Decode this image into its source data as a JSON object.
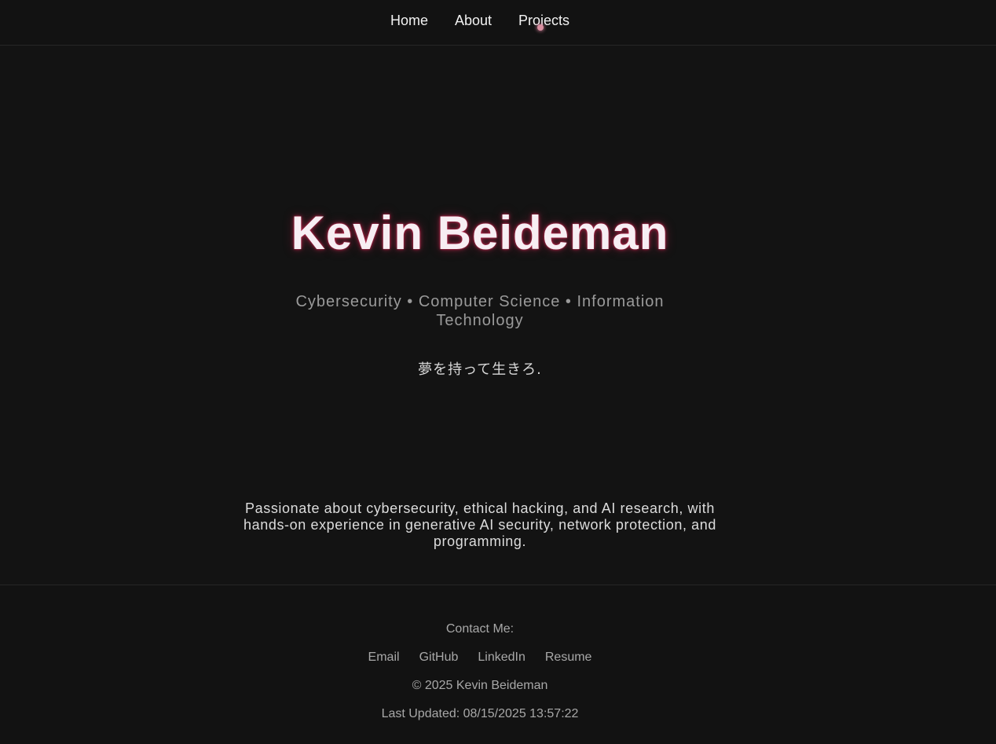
{
  "nav": {
    "items": [
      {
        "label": "Home"
      },
      {
        "label": "About"
      },
      {
        "label": "Projects"
      }
    ]
  },
  "hero": {
    "name": "Kevin Beideman",
    "subtitle": "Cybersecurity • Computer Science • Information Technology",
    "motto": "夢を持って生きろ.",
    "bio": "Passionate about cybersecurity, ethical hacking, and AI research, with hands-on experience in generative AI security, network protection, and programming."
  },
  "footer": {
    "contact_title": "Contact Me:",
    "links": [
      {
        "label": "Email"
      },
      {
        "label": "GitHub"
      },
      {
        "label": "LinkedIn"
      },
      {
        "label": "Resume"
      }
    ],
    "copyright": "© 2025 Kevin Beideman",
    "last_updated": "Last Updated: 08/15/2025 13:57:22"
  },
  "colors": {
    "background": "#131313",
    "name_glow": "#c2254f",
    "text_muted": "#a8a8a8"
  }
}
